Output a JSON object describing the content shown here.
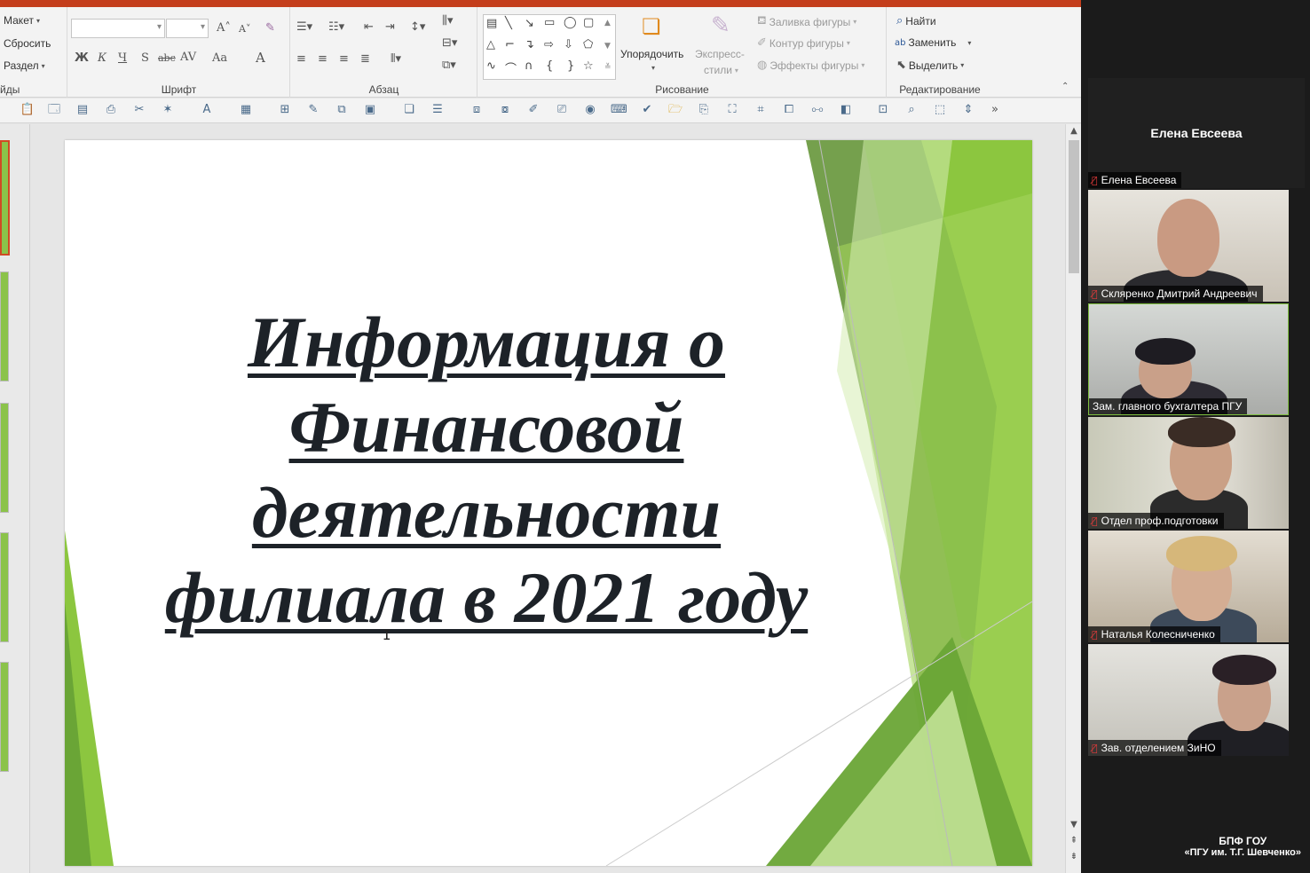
{
  "ribbon": {
    "slides_group": {
      "layout": "Макет",
      "reset": "Сбросить",
      "section": "Раздел",
      "label_partial": "йды"
    },
    "font_group": {
      "label": "Шрифт",
      "bold": "Ж",
      "italic": "К",
      "underline": "Ч",
      "shadow": "S",
      "strike": "abc",
      "case": "Aa"
    },
    "paragraph_group": {
      "label": "Абзац"
    },
    "drawing_group": {
      "label": "Рисование",
      "arrange": "Упорядочить",
      "quick_styles_1": "Экспресс-",
      "quick_styles_2": "стили",
      "shape_fill": "Заливка фигуры",
      "shape_outline": "Контур фигуры",
      "shape_effects": "Эффекты фигуры"
    },
    "editing_group": {
      "label": "Редактирование",
      "find": "Найти",
      "replace": "Заменить",
      "select": "Выделить"
    }
  },
  "slide": {
    "title_lines": [
      "Информация о",
      "Финансовой",
      "деятельности",
      "филиала в 2021 году"
    ]
  },
  "video_panel": {
    "active_speaker": "Елена Евсеева",
    "participants": [
      {
        "name": "Елена Евсеева"
      },
      {
        "name": "Скляренко Дмитрий Андреевич"
      },
      {
        "name": "Зам. главного бухгалтера ПГУ"
      },
      {
        "name": "Отдел проф.подготовки"
      },
      {
        "name": "Наталья Колесниченко"
      },
      {
        "name": "Зав. отделением ЗиНО"
      }
    ],
    "brand_line1": "БПФ ГОУ",
    "brand_line2": "«ПГУ им. Т.Г. Шевченко»"
  },
  "colors": {
    "accent": "#c43e1c",
    "slide_green": "#8bc34a",
    "muted_mic": "#e23b3b"
  }
}
